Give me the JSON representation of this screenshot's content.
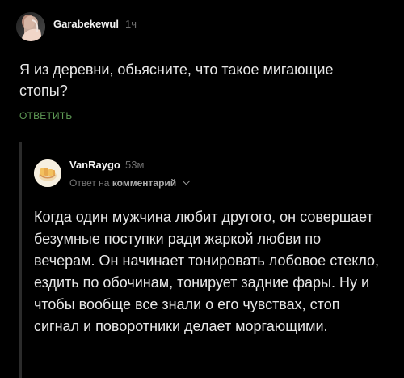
{
  "top_comment": {
    "username": "Garabekewul",
    "time": "1ч",
    "text": "Я из деревни, обьясните, что такое мигающие стопы?",
    "reply_label": "ОТВЕТИТЬ",
    "avatar_icon": "user-avatar-photo-icon"
  },
  "reply": {
    "username": "VanRaygo",
    "time": "53м",
    "reply_prefix": "Ответ на",
    "reply_target": "комментарий",
    "avatar_icon": "user-avatar-cartoon-icon",
    "text": "Когда один мужчина любит другого, он совершает безумные поступки ради жаркой любви по вечерам. Он начинает тонировать лобовое стекло, ездить по обочинам, тонирует задние фары. Ну и чтобы вообще все знали о его чувствах, стоп сигнал и поворотники делает моргающими."
  },
  "colors": {
    "background": "#000000",
    "text": "#e7e7e7",
    "muted": "#6f6f6f",
    "accent": "#5f9b56"
  }
}
